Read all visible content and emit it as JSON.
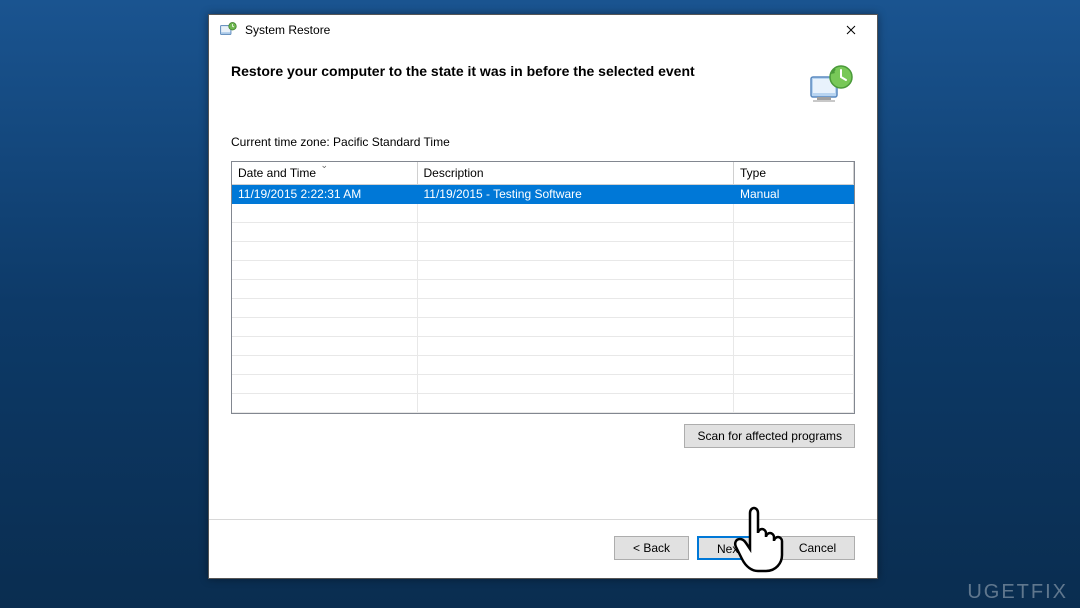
{
  "window": {
    "title": "System Restore"
  },
  "header": {
    "title": "Restore your computer to the state it was in before the selected event"
  },
  "timezone": "Current time zone: Pacific Standard Time",
  "table": {
    "columns": {
      "datetime": "Date and Time",
      "description": "Description",
      "type": "Type"
    },
    "rows": [
      {
        "datetime": "11/19/2015 2:22:31 AM",
        "description": "11/19/2015 - Testing Software",
        "type": "Manual",
        "selected": true
      }
    ]
  },
  "buttons": {
    "scan": "Scan for affected programs",
    "back": "< Back",
    "next": "Next >",
    "cancel": "Cancel"
  },
  "watermark": "UGETFIX"
}
